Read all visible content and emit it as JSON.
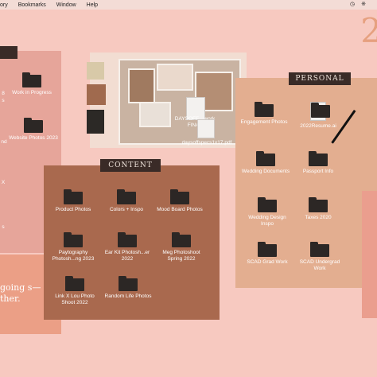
{
  "menubar": {
    "items": [
      "ory",
      "Bookmarks",
      "Window",
      "Help"
    ]
  },
  "big_digit": "2",
  "left_panel": {
    "labels": [
      {
        "text": "8"
      },
      {
        "text": "s"
      },
      {
        "text": "nd"
      },
      {
        "text": "X"
      },
      {
        "text": "s"
      }
    ],
    "folders": [
      {
        "label": "Work in Progress"
      },
      {
        "label": "Website Photos 2023"
      }
    ]
  },
  "quote_text": "going s— all ther.",
  "photo_panel": {
    "file_label": "DAYSOFF... work FINAL",
    "file2_label": "daysoffspecs1x17.pdf"
  },
  "content_panel": {
    "title": "CONTENT",
    "folders": [
      {
        "label": "Product Photos"
      },
      {
        "label": "Colors + Inspo"
      },
      {
        "label": "Mood Board Photos"
      },
      {
        "label": "Paytography Photosh...ng 2023"
      },
      {
        "label": "Ear Kit Photosh...er 2022"
      },
      {
        "label": "Meg Photoshoot Spring 2022"
      },
      {
        "label": "Link X Lou Photo Shoot 2022"
      },
      {
        "label": "Random Life Photos"
      }
    ]
  },
  "personal_panel": {
    "title": "PERSONAL",
    "items": [
      {
        "label": "Engagement Photos",
        "kind": "folder"
      },
      {
        "label": "2022Resume.ai",
        "kind": "doc"
      },
      {
        "label": "Wedding Documents",
        "kind": "folder"
      },
      {
        "label": "Passport Info",
        "kind": "folder"
      },
      {
        "label": "Wedding Design Inspo",
        "kind": "folder"
      },
      {
        "label": "Taxes 2020",
        "kind": "folder"
      },
      {
        "label": "SCAD Grad Work",
        "kind": "folder"
      },
      {
        "label": "SCAD Undergrad Work",
        "kind": "folder"
      }
    ]
  },
  "colors": {
    "desktop_bg": "#f7c9c0",
    "content_bg": "#a9694e",
    "personal_bg": "#e3ae90",
    "tag_bg": "#3a2b27",
    "folder": "#2c2725"
  }
}
